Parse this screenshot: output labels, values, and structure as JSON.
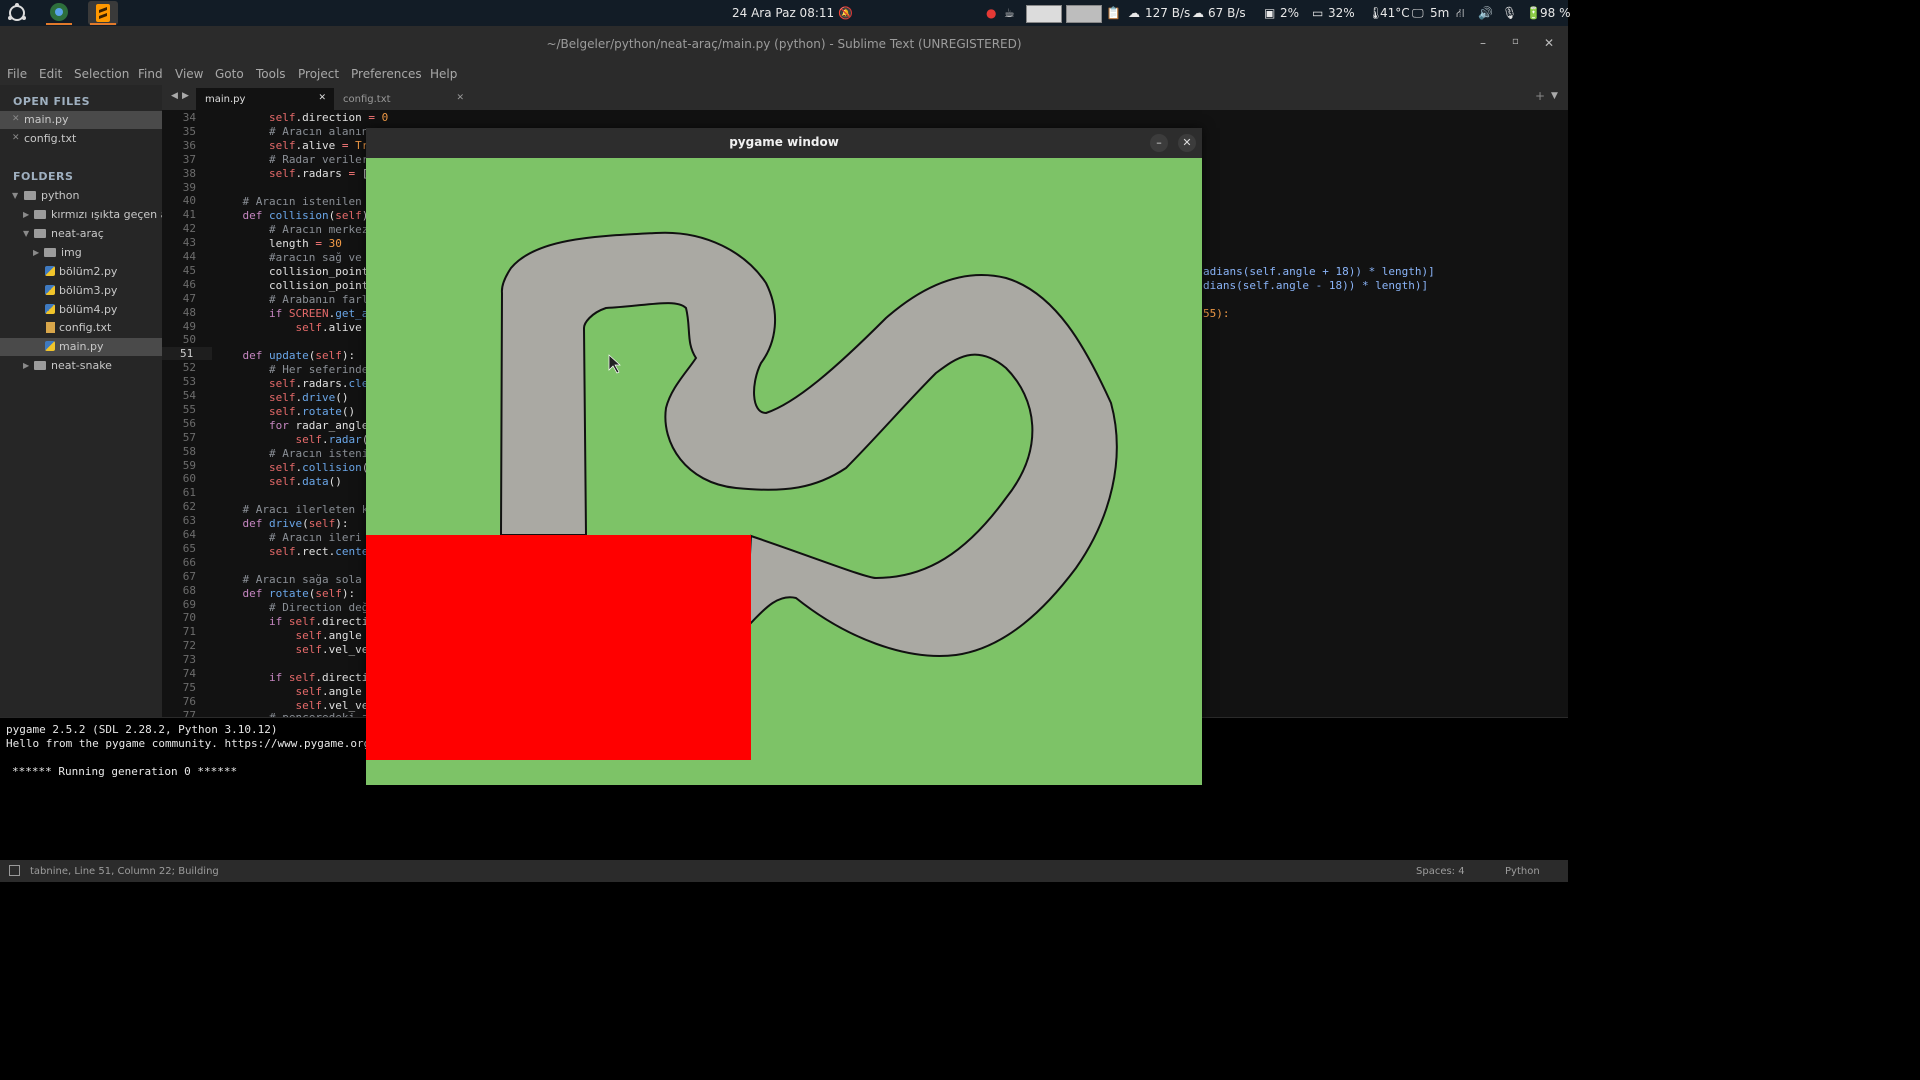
{
  "panel": {
    "datetime": "24 Ara Paz  08:11",
    "upload": "127 B/s",
    "download": "67 B/s",
    "disk": "2%",
    "mem": "32%",
    "temp": "41°C",
    "uptime": "5m",
    "battery": "98 %"
  },
  "window": {
    "title": "~/Belgeler/python/neat-araç/main.py (python) - Sublime Text (UNREGISTERED)"
  },
  "menu": [
    "File",
    "Edit",
    "Selection",
    "Find",
    "View",
    "Goto",
    "Tools",
    "Project",
    "Preferences",
    "Help"
  ],
  "sidebar": {
    "open_files_header": "OPEN FILES",
    "open_files": [
      "main.py",
      "config.txt"
    ],
    "folders_header": "FOLDERS",
    "tree": [
      {
        "label": "python"
      },
      {
        "label": "kırmızı ışıkta geçen araç"
      },
      {
        "label": "neat-araç"
      },
      {
        "label": "img"
      },
      {
        "label": "bölüm2.py"
      },
      {
        "label": "bölüm3.py"
      },
      {
        "label": "bölüm4.py"
      },
      {
        "label": "config.txt"
      },
      {
        "label": "main.py"
      },
      {
        "label": "neat-snake"
      }
    ]
  },
  "tabs": [
    "main.py",
    "config.txt"
  ],
  "editor": {
    "line_numbers": [
      "34",
      "35",
      "36",
      "37",
      "38",
      "39",
      "40",
      "41",
      "42",
      "43",
      "44",
      "45",
      "46",
      "47",
      "48",
      "49",
      "50",
      "51",
      "52",
      "53",
      "54",
      "55",
      "56",
      "57",
      "58",
      "59",
      "60",
      "61",
      "62",
      "63",
      "64",
      "65",
      "66",
      "67",
      "68",
      "69",
      "70",
      "71",
      "72",
      "73",
      "74",
      "75",
      "76",
      "77"
    ],
    "current_line": "51",
    "right_fragments": [
      "adians(self.angle + 18)) * length)]",
      "dians(self.angle - 18)) * length)]",
      "55):"
    ]
  },
  "console": {
    "lines": [
      "pygame 2.5.2 (SDL 2.28.2, Python 3.10.12)",
      "Hello from the pygame community. https://www.pygame.org",
      "",
      "****** Running generation 0 ******"
    ]
  },
  "status": {
    "left": "tabnine, Line 51, Column 22; Building",
    "spaces": "Spaces: 4",
    "syntax": "Python"
  },
  "pygame": {
    "title": "pygame window",
    "bg_color": "#7dc367",
    "track_color": "#aaa9a3",
    "car_box_color": "#ff0000"
  }
}
